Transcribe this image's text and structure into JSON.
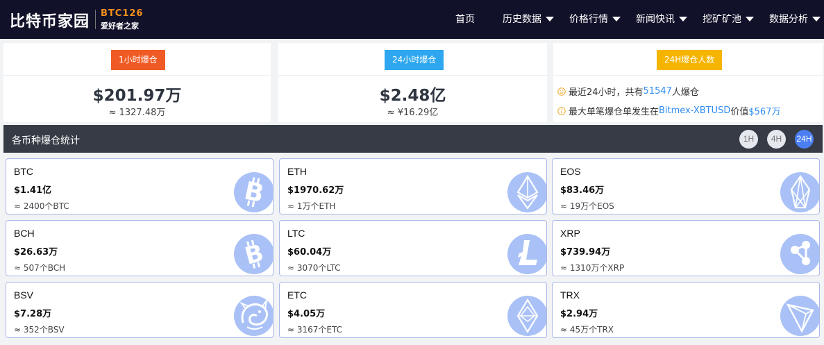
{
  "header": {
    "logo_cn": "比特币家园",
    "logo_en": "BTC126",
    "logo_slogan": "爱好者之家",
    "nav": [
      {
        "label": "首页"
      },
      {
        "label": "历史数据"
      },
      {
        "label": "价格行情"
      },
      {
        "label": "新闻快讯"
      },
      {
        "label": "挖矿矿池"
      },
      {
        "label": "数据分析"
      }
    ]
  },
  "summary": {
    "hour1": {
      "badge": "1小时爆仓",
      "value": "$201.97万",
      "sub": "≈ 1327.48万",
      "color": "#f05a24"
    },
    "hour24": {
      "badge": "24小时爆仓",
      "value": "$2.48亿",
      "sub": "≈ ¥16.29亿",
      "color": "#2ea7f0"
    },
    "people": {
      "badge": "24H爆仓人数",
      "color": "#f5b400",
      "line1_a": "最近24小时，共有",
      "line1_count": "51547",
      "line1_b": "人爆仓",
      "line2_a": "最大单笔爆仓单发生在",
      "line2_market": "Bitmex-XBTUSD",
      "line2_b": "价值",
      "line2_value": "$567万"
    }
  },
  "stats": {
    "title": "各币种爆仓统计",
    "buttons": [
      "1H",
      "4H",
      "24H"
    ],
    "active": "24H"
  },
  "coins": [
    {
      "name": "BTC",
      "value": "$1.41亿",
      "amount": "≈ 2400个BTC",
      "icon": "bitcoin-icon"
    },
    {
      "name": "ETH",
      "value": "$1970.62万",
      "amount": "≈ 1万个ETH",
      "icon": "ethereum-icon"
    },
    {
      "name": "EOS",
      "value": "$83.46万",
      "amount": "≈ 19万个EOS",
      "icon": "eos-icon"
    },
    {
      "name": "BCH",
      "value": "$26.63万",
      "amount": "≈ 507个BCH",
      "icon": "bitcoin-cash-icon"
    },
    {
      "name": "LTC",
      "value": "$60.04万",
      "amount": "≈ 3070个LTC",
      "icon": "litecoin-icon"
    },
    {
      "name": "XRP",
      "value": "$739.94万",
      "amount": "≈ 1310万个XRP",
      "icon": "ripple-icon"
    },
    {
      "name": "BSV",
      "value": "$7.28万",
      "amount": "≈ 352个BSV",
      "icon": "dragon-icon"
    },
    {
      "name": "ETC",
      "value": "$4.05万",
      "amount": "≈ 3167个ETC",
      "icon": "ethereum-classic-icon"
    },
    {
      "name": "TRX",
      "value": "$2.94万",
      "amount": "≈ 45万个TRX",
      "icon": "tron-icon"
    }
  ],
  "colors": {
    "header_bg": "#12112a",
    "accent": "#2d8cf0",
    "icon_tint": "#a9c1f6"
  }
}
